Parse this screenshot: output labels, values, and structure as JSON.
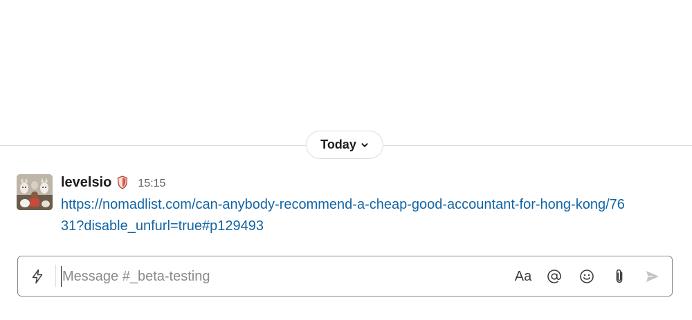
{
  "divider": {
    "date_label": "Today",
    "chevron_icon": "chevron-down-icon"
  },
  "message": {
    "author": "levelsio",
    "badge_icon": "shield-badge-icon",
    "timestamp": "15:15",
    "link_text": "https://nomadlist.com/can-anybody-recommend-a-cheap-good-accountant-for-hong-kong/7631?disable_unfurl=true#p129493",
    "link_color": "#1264a3"
  },
  "composer": {
    "placeholder": "Message #_beta-testing",
    "value": "",
    "shortcuts_icon": "lightning-icon",
    "format_label": "Aa",
    "mention_icon": "at-icon",
    "emoji_icon": "smiley-icon",
    "attach_icon": "paperclip-icon",
    "send_icon": "send-icon"
  },
  "colors": {
    "text": "#1d1c1d",
    "muted": "#616061",
    "border": "#868686",
    "divider": "#dddddd"
  }
}
